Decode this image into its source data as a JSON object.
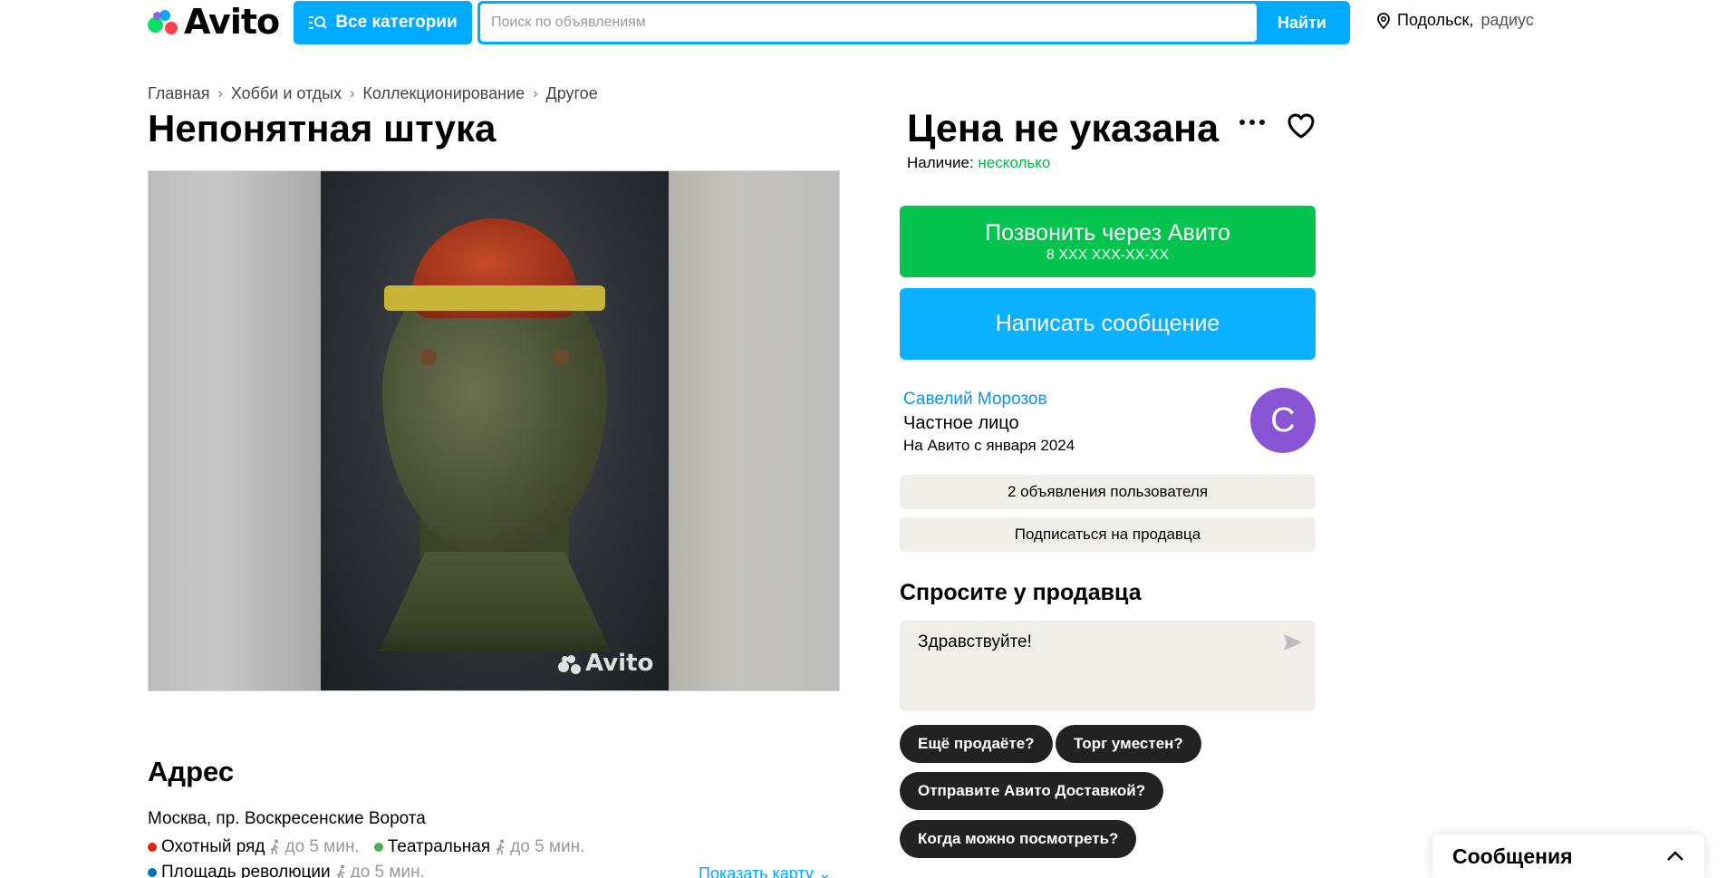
{
  "header": {
    "logo_text": "Avito",
    "categories_label": "Все категории",
    "search_placeholder": "Поиск по объявлениям",
    "search_button": "Найти",
    "location_city": "Подольск,",
    "location_radius": "радиус"
  },
  "breadcrumb": [
    "Главная",
    "Хобби и отдых",
    "Коллекционирование",
    "Другое"
  ],
  "listing": {
    "title": "Непонятная штука",
    "photo_watermark": "Avito"
  },
  "address": {
    "heading": "Адрес",
    "line": "Москва, пр. Воскресенские Ворота",
    "metro": [
      {
        "name": "Охотный ряд",
        "walk": "до 5 мин.",
        "color": "#e42313"
      },
      {
        "name": "Театральная",
        "walk": "до 5 мин.",
        "color": "#4baf4f"
      },
      {
        "name": "Площадь революции",
        "walk": "до 5 мин.",
        "color": "#0072ba"
      }
    ],
    "map_link": "Показать карту"
  },
  "sidebar": {
    "price": "Цена не указана",
    "availability_label": "Наличие:",
    "availability_value": "несколько",
    "call_button": "Позвонить через Авито",
    "call_phone": "8 XXX XXX-XX-XX",
    "message_button": "Написать сообщение",
    "seller_name": "Савелий Морозов",
    "seller_type": "Частное лицо",
    "seller_since": "На Авито с января 2024",
    "avatar_letter": "С",
    "ads_button": "2 объявления пользователя",
    "subscribe_button": "Подписаться на продавца",
    "ask_heading": "Спросите у продавца",
    "ask_text": "Здравствуйте!",
    "quick_questions": [
      "Ещё продаёте?",
      "Торг уместен?",
      "Отправите Авито Доставкой?",
      "Когда можно посмотреть?"
    ]
  },
  "messages_panel": {
    "title": "Сообщения"
  },
  "colors": {
    "accent_blue": "#00aaff",
    "call_green": "#04c34e",
    "avatar_purple": "#8a55d4"
  }
}
